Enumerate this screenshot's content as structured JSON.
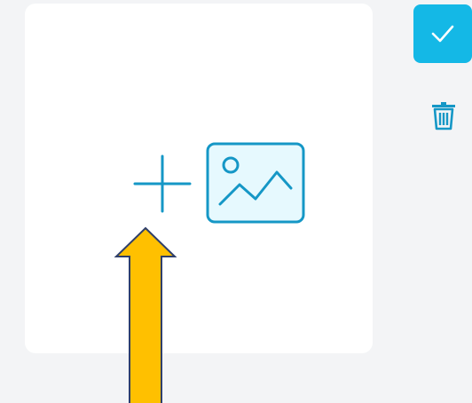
{
  "colors": {
    "page_background": "#f3f4f6",
    "card_background": "#ffffff",
    "accent": "#14b8e6",
    "icon_stroke": "#1597c6",
    "image_icon_fill": "#e6f9fe",
    "arrow_fill": "#ffc000",
    "arrow_stroke": "#2f3f6b"
  },
  "icons": {
    "add": "plus-icon",
    "image": "image-icon",
    "confirm": "checkmark-icon",
    "delete": "trash-icon",
    "annotation": "arrow-up-icon"
  }
}
